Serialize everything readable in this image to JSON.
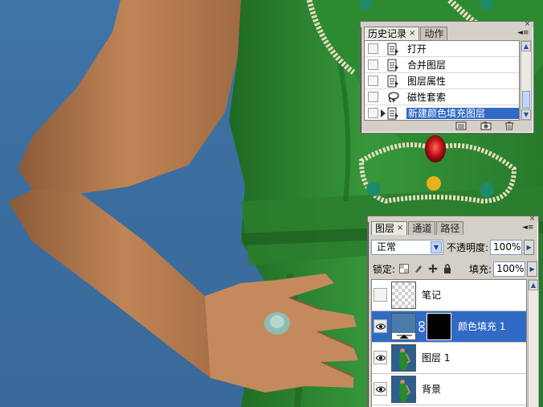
{
  "history_panel": {
    "tabs": [
      {
        "label": "历史记录",
        "active": true
      },
      {
        "label": "动作",
        "active": false
      }
    ],
    "close_glyph": "×",
    "items": [
      {
        "label": "打开",
        "icon": "document-icon",
        "selected": false
      },
      {
        "label": "合并图层",
        "icon": "document-icon",
        "selected": false
      },
      {
        "label": "图层属性",
        "icon": "document-icon",
        "selected": false
      },
      {
        "label": "磁性套索",
        "icon": "magnetic-lasso-icon",
        "selected": false
      },
      {
        "label": "新建颜色填充图层",
        "icon": "document-icon",
        "selected": true
      }
    ],
    "footer_icons": [
      "new-document-icon",
      "snapshot-icon",
      "trash-icon"
    ]
  },
  "layers_panel": {
    "tabs": [
      {
        "label": "图层",
        "active": true
      },
      {
        "label": "通道",
        "active": false
      },
      {
        "label": "路径",
        "active": false
      }
    ],
    "close_glyph": "×",
    "blend_mode": "正常",
    "opacity_label": "不透明度:",
    "opacity_value": "100%",
    "lock_label": "锁定:",
    "fill_label": "填充:",
    "fill_value": "100%",
    "layers": [
      {
        "name": "笔记",
        "visible": false,
        "selected": false,
        "thumb": "transparent"
      },
      {
        "name": "颜色填充 1",
        "visible": true,
        "selected": true,
        "thumb": "color-fill",
        "fill_color": "#4a7baa"
      },
      {
        "name": "图层 1",
        "visible": true,
        "selected": false,
        "thumb": "photo"
      },
      {
        "name": "背景",
        "visible": true,
        "selected": false,
        "thumb": "photo"
      }
    ]
  },
  "colors": {
    "selection": "#316ac5",
    "background_blue": "#3f74a6",
    "dress_green": "#2f8a32",
    "skin": "#b97a52"
  }
}
